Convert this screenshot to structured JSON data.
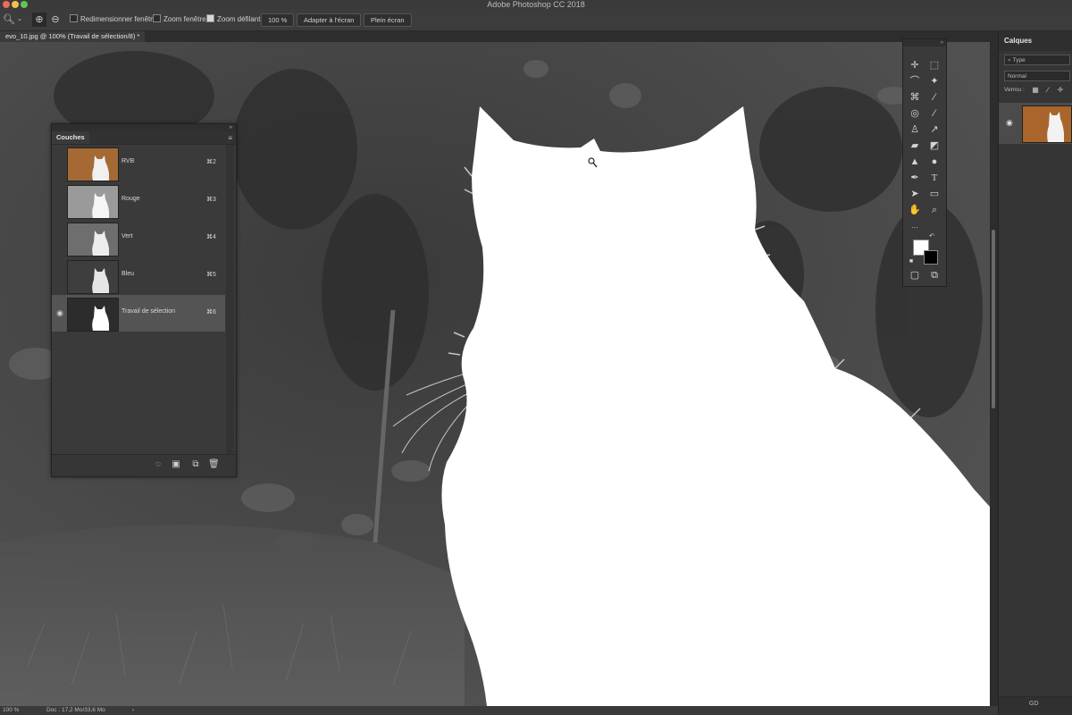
{
  "app": {
    "title": "Adobe Photoshop CC 2018"
  },
  "options_bar": {
    "tool_icon": "zoom-icon",
    "zoom_in_icon": "zoom-in-icon",
    "zoom_out_icon": "zoom-out-icon",
    "resize_windows": {
      "label": "Redimensionner fenêtres",
      "checked": false
    },
    "zoom_all_windows": {
      "label": "Zoom fenêtres",
      "checked": false
    },
    "scrubby_zoom": {
      "label": "Zoom défilant",
      "checked": true
    },
    "zoom_value": "100 %",
    "fit_screen_label": "Adapter à l'écran",
    "fill_screen_label": "Plein écran"
  },
  "document": {
    "tab_label": "evo_10.jpg @ 100% (Travail de sélection/8) *"
  },
  "status": {
    "zoom": "100 %",
    "doc": "Doc : 17,2 Mo/33,6 Mo"
  },
  "channels_panel": {
    "title": "Couches",
    "channels": [
      {
        "name": "RVB",
        "shortcut": "⌘2",
        "visible": false,
        "selected": false,
        "thumb": "color"
      },
      {
        "name": "Rouge",
        "shortcut": "⌘3",
        "visible": false,
        "selected": false,
        "thumb": "light"
      },
      {
        "name": "Vert",
        "shortcut": "⌘4",
        "visible": false,
        "selected": false,
        "thumb": "mid"
      },
      {
        "name": "Bleu",
        "shortcut": "⌘5",
        "visible": false,
        "selected": false,
        "thumb": "dark"
      },
      {
        "name": "Travail de sélection",
        "shortcut": "⌘6",
        "visible": true,
        "selected": true,
        "thumb": "mask"
      }
    ],
    "bottom_icons": [
      "load-selection-icon",
      "save-selection-icon",
      "new-channel-icon",
      "delete-channel-icon"
    ]
  },
  "layers_panel": {
    "title": "Calques",
    "kind_placeholder": "Type",
    "blend_mode": "Normal",
    "lock_label": "Verrou :",
    "layer_thumb_colors": {
      "bg": "#a9652c",
      "subject": "#f2f2f2"
    },
    "fx_label": "GD"
  },
  "colors": {
    "foreground": "#ffffff",
    "background": "#000000",
    "panel": "#3a3a3a",
    "selected_row": "#545454"
  },
  "toolbar": {
    "tools": [
      "move-icon",
      "marquee-icon",
      "lasso-icon",
      "magic-wand-icon",
      "crop-icon",
      "eyedropper-icon",
      "healing-icon",
      "brush-icon",
      "stamp-icon",
      "history-brush-icon",
      "eraser-icon",
      "paint-bucket-icon",
      "blur-icon",
      "dodge-icon",
      "pen-icon",
      "type-icon",
      "path-select-icon",
      "rectangle-icon",
      "hand-icon",
      "zoom-tool-icon"
    ]
  }
}
